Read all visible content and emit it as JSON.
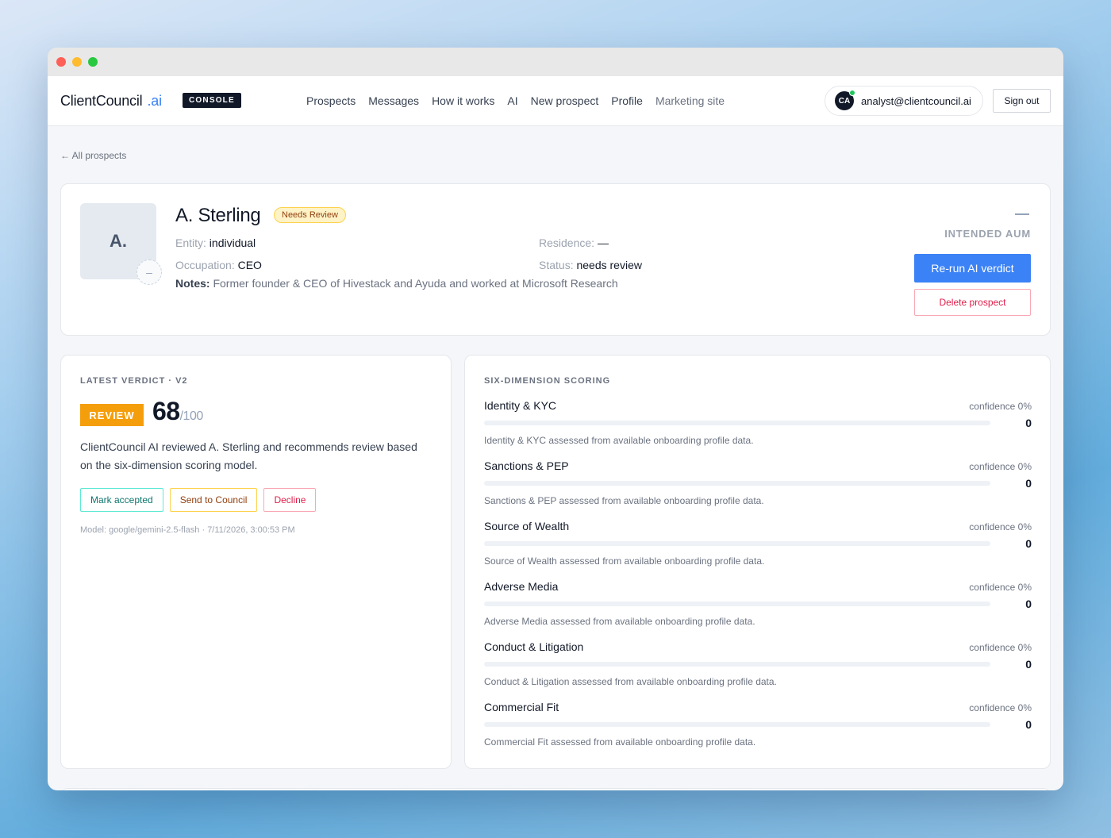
{
  "nav": {
    "brand": "ClientCouncil",
    "brand_suffix": ".ai",
    "console_badge": "CONSOLE",
    "links": [
      "Prospects",
      "Messages",
      "How it works",
      "AI",
      "New prospect",
      "Profile"
    ],
    "marketing": "Marketing site",
    "user_initials": "CA",
    "user_email": "analyst@clientcouncil.ai",
    "sign_out": "Sign out"
  },
  "back_link": "← All prospects",
  "prospect": {
    "initial": "A.",
    "initial_sub": "–",
    "name": "A. Sterling",
    "status_badge": "Needs Review",
    "entity_label": "Entity:",
    "entity": "individual",
    "residence_label": "Residence:",
    "residence": "—",
    "occupation_label": "Occupation:",
    "occupation": "CEO",
    "status_label": "Status:",
    "status": "needs review",
    "notes_label": "Notes:",
    "notes": "Former founder & CEO of Hivestack and Ayuda and worked at Microsoft Research",
    "aum_label": "INTENDED AUM",
    "rerun_button": "Re-run AI verdict",
    "delete_button": "Delete prospect"
  },
  "verdict": {
    "section_label": "LATEST VERDICT · V2",
    "badge": "REVIEW",
    "score": "68",
    "score_out_of": "/100",
    "score_value": 68,
    "summary": "ClientCouncil AI reviewed A. Sterling and recommends review based on the six-dimension scoring model.",
    "accept_button": "Mark accepted",
    "council_button": "Send to Council",
    "decline_button": "Decline",
    "model_line": "Model: google/gemini-2.5-flash · 7/11/2026, 3:00:53 PM"
  },
  "scoring": {
    "section_label": "SIX-DIMENSION SCORING",
    "dimensions": [
      {
        "name": "Identity & KYC",
        "confidence": "confidence 0%",
        "value": "0",
        "fill": 0,
        "description": "Identity & KYC assessed from available onboarding profile data."
      },
      {
        "name": "Sanctions & PEP",
        "confidence": "confidence 0%",
        "value": "0",
        "fill": 0,
        "description": "Sanctions & PEP assessed from available onboarding profile data."
      },
      {
        "name": "Source of Wealth",
        "confidence": "confidence 0%",
        "value": "0",
        "fill": 0,
        "description": "Source of Wealth assessed from available onboarding profile data."
      },
      {
        "name": "Adverse Media",
        "confidence": "confidence 0%",
        "value": "0",
        "fill": 0,
        "description": "Adverse Media assessed from available onboarding profile data."
      },
      {
        "name": "Conduct & Litigation",
        "confidence": "confidence 0%",
        "value": "0",
        "fill": 0,
        "description": "Conduct & Litigation assessed from available onboarding profile data."
      },
      {
        "name": "Commercial Fit",
        "confidence": "confidence 0%",
        "value": "0",
        "fill": 0,
        "description": "Commercial Fit assessed from available onboarding profile data."
      }
    ]
  }
}
